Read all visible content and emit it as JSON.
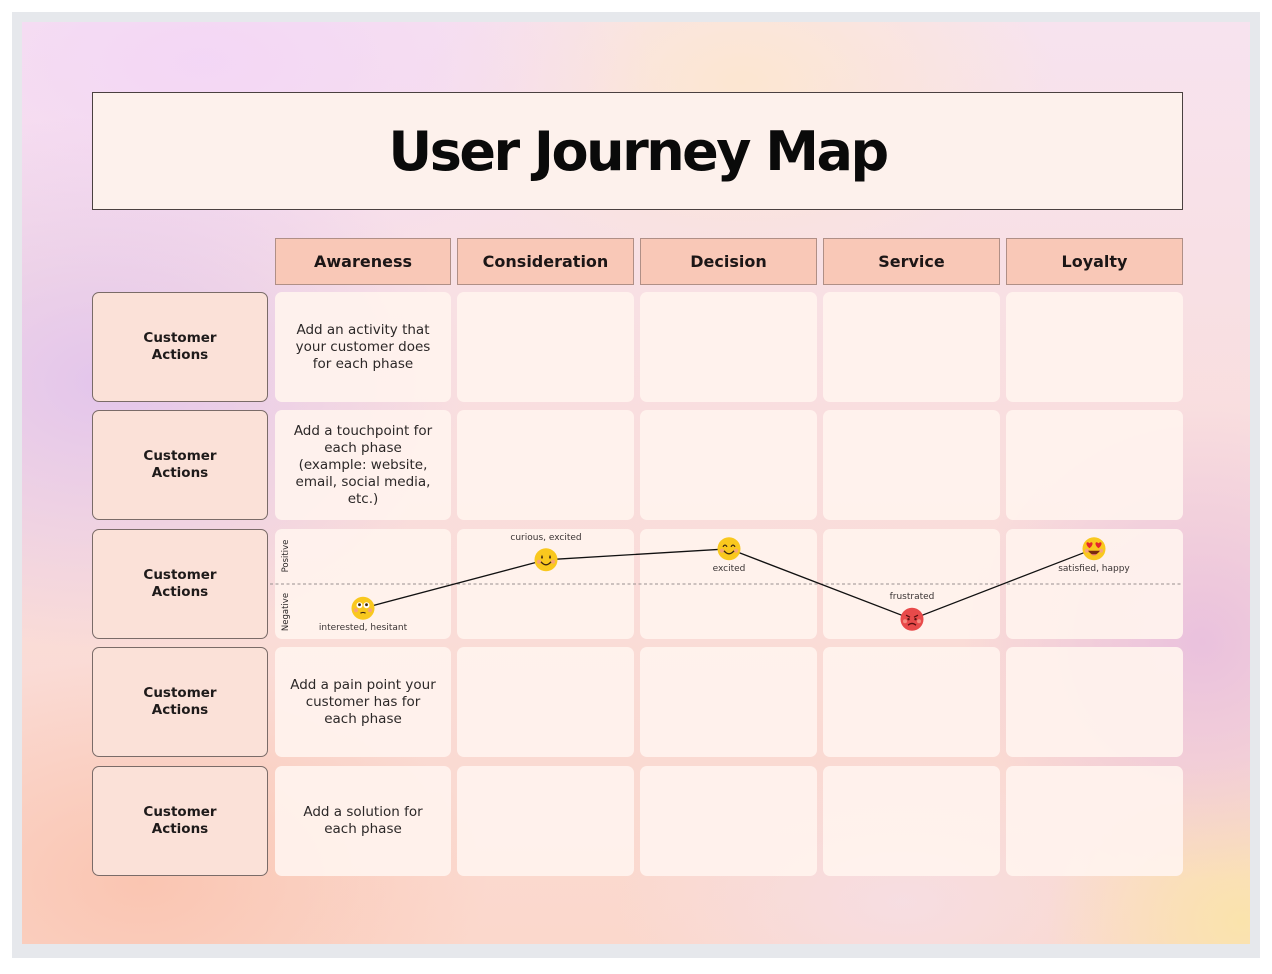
{
  "title": "User Journey Map",
  "phases": [
    {
      "label": "Awareness"
    },
    {
      "label": "Consideration"
    },
    {
      "label": "Decision"
    },
    {
      "label": "Service"
    },
    {
      "label": "Loyalty"
    }
  ],
  "rows": [
    {
      "label": "Customer Actions",
      "cells": [
        "Add an activity that your customer does for each phase",
        "",
        "",
        "",
        ""
      ]
    },
    {
      "label": "Customer Actions",
      "cells": [
        "Add a touchpoint for each phase (example: website, email, social media, etc.)",
        "",
        "",
        "",
        ""
      ]
    },
    {
      "label": "Customer Actions",
      "type": "emotion"
    },
    {
      "label": "Customer Actions",
      "cells": [
        "Add a pain point your customer has for each phase",
        "",
        "",
        "",
        ""
      ]
    },
    {
      "label": "Customer Actions",
      "cells": [
        "Add a solution for each phase",
        "",
        "",
        "",
        ""
      ]
    }
  ],
  "emotion_axis": {
    "positive_label": "Positive",
    "negative_label": "Negative"
  },
  "emotions": [
    {
      "phase": "Awareness",
      "label": "interested, hesitant",
      "face": "worried-face",
      "sentiment": -0.55,
      "color": "#f9c81e"
    },
    {
      "phase": "Consideration",
      "label": "curious, excited",
      "face": "starry-smile-face",
      "sentiment": 0.55,
      "color": "#f9c81e"
    },
    {
      "phase": "Decision",
      "label": "excited",
      "face": "happy-smile-face",
      "sentiment": 0.8,
      "color": "#f9c81e"
    },
    {
      "phase": "Service",
      "label": "frustrated",
      "face": "angry-face",
      "sentiment": -0.8,
      "color": "#e84a4a"
    },
    {
      "phase": "Loyalty",
      "label": "satisfied, happy",
      "face": "heart-eyes-face",
      "sentiment": 0.8,
      "color": "#f9c81e"
    }
  ]
}
